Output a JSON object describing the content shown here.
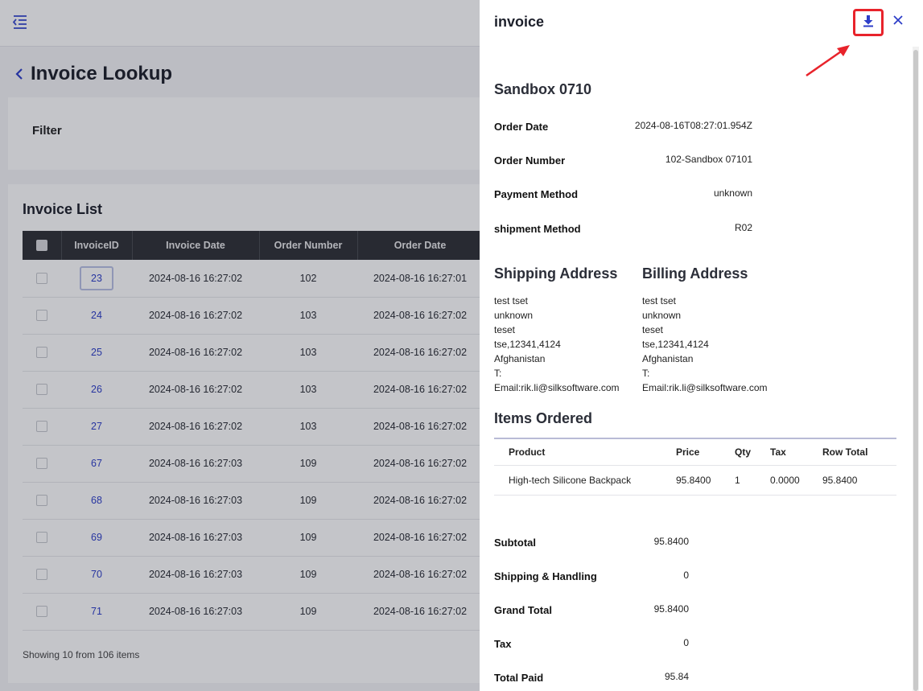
{
  "icons": {
    "menu": "menu-collapse-icon",
    "back": "chevron-left-icon",
    "download": "download-icon",
    "close": "close-icon"
  },
  "colors": {
    "accent": "#2d3ec8",
    "highlight": "#e8232b",
    "header_bg": "#2f3136"
  },
  "page": {
    "title": "Invoice Lookup"
  },
  "filter": {
    "title": "Filter"
  },
  "invoice_list": {
    "title": "Invoice List",
    "columns": [
      "InvoiceID",
      "Invoice Date",
      "Order Number",
      "Order Date"
    ],
    "rows": [
      {
        "id": "23",
        "invoice_date": "2024-08-16 16:27:02",
        "order_number": "102",
        "order_date": "2024-08-16 16:27:01"
      },
      {
        "id": "24",
        "invoice_date": "2024-08-16 16:27:02",
        "order_number": "103",
        "order_date": "2024-08-16 16:27:02"
      },
      {
        "id": "25",
        "invoice_date": "2024-08-16 16:27:02",
        "order_number": "103",
        "order_date": "2024-08-16 16:27:02"
      },
      {
        "id": "26",
        "invoice_date": "2024-08-16 16:27:02",
        "order_number": "103",
        "order_date": "2024-08-16 16:27:02"
      },
      {
        "id": "27",
        "invoice_date": "2024-08-16 16:27:02",
        "order_number": "103",
        "order_date": "2024-08-16 16:27:02"
      },
      {
        "id": "67",
        "invoice_date": "2024-08-16 16:27:03",
        "order_number": "109",
        "order_date": "2024-08-16 16:27:02"
      },
      {
        "id": "68",
        "invoice_date": "2024-08-16 16:27:03",
        "order_number": "109",
        "order_date": "2024-08-16 16:27:02"
      },
      {
        "id": "69",
        "invoice_date": "2024-08-16 16:27:03",
        "order_number": "109",
        "order_date": "2024-08-16 16:27:02"
      },
      {
        "id": "70",
        "invoice_date": "2024-08-16 16:27:03",
        "order_number": "109",
        "order_date": "2024-08-16 16:27:02"
      },
      {
        "id": "71",
        "invoice_date": "2024-08-16 16:27:03",
        "order_number": "109",
        "order_date": "2024-08-16 16:27:02"
      }
    ],
    "showing": "Showing 10 from 106 items"
  },
  "drawer": {
    "title": "invoice",
    "store": "Sandbox 0710",
    "order_info": [
      {
        "label": "Order Date",
        "value": "2024-08-16T08:27:01.954Z"
      },
      {
        "label": "Order Number",
        "value": "102-Sandbox 07101"
      },
      {
        "label": "Payment Method",
        "value": "unknown"
      },
      {
        "label": "shipment Method",
        "value": "R02"
      }
    ],
    "shipping": {
      "title": "Shipping Address",
      "lines": [
        "test tset",
        "unknown",
        "teset",
        "tse,12341,4124",
        "Afghanistan",
        "T:",
        "Email:rik.li@silksoftware.com"
      ]
    },
    "billing": {
      "title": "Billing Address",
      "lines": [
        "test tset",
        "unknown",
        "teset",
        "tse,12341,4124",
        "Afghanistan",
        "T:",
        "Email:rik.li@silksoftware.com"
      ]
    },
    "items": {
      "title": "Items Ordered",
      "columns": [
        "Product",
        "Price",
        "Qty",
        "Tax",
        "Row Total"
      ],
      "rows": [
        {
          "product": "High-tech Silicone Backpack",
          "price": "95.8400",
          "qty": "1",
          "tax": "0.0000",
          "row_total": "95.8400"
        }
      ]
    },
    "totals": [
      {
        "label": "Subtotal",
        "value": "95.8400"
      },
      {
        "label": "Shipping & Handling",
        "value": "0"
      },
      {
        "label": "Grand Total",
        "value": "95.8400"
      },
      {
        "label": "Tax",
        "value": "0"
      },
      {
        "label": "Total Paid",
        "value": "95.84"
      }
    ]
  }
}
